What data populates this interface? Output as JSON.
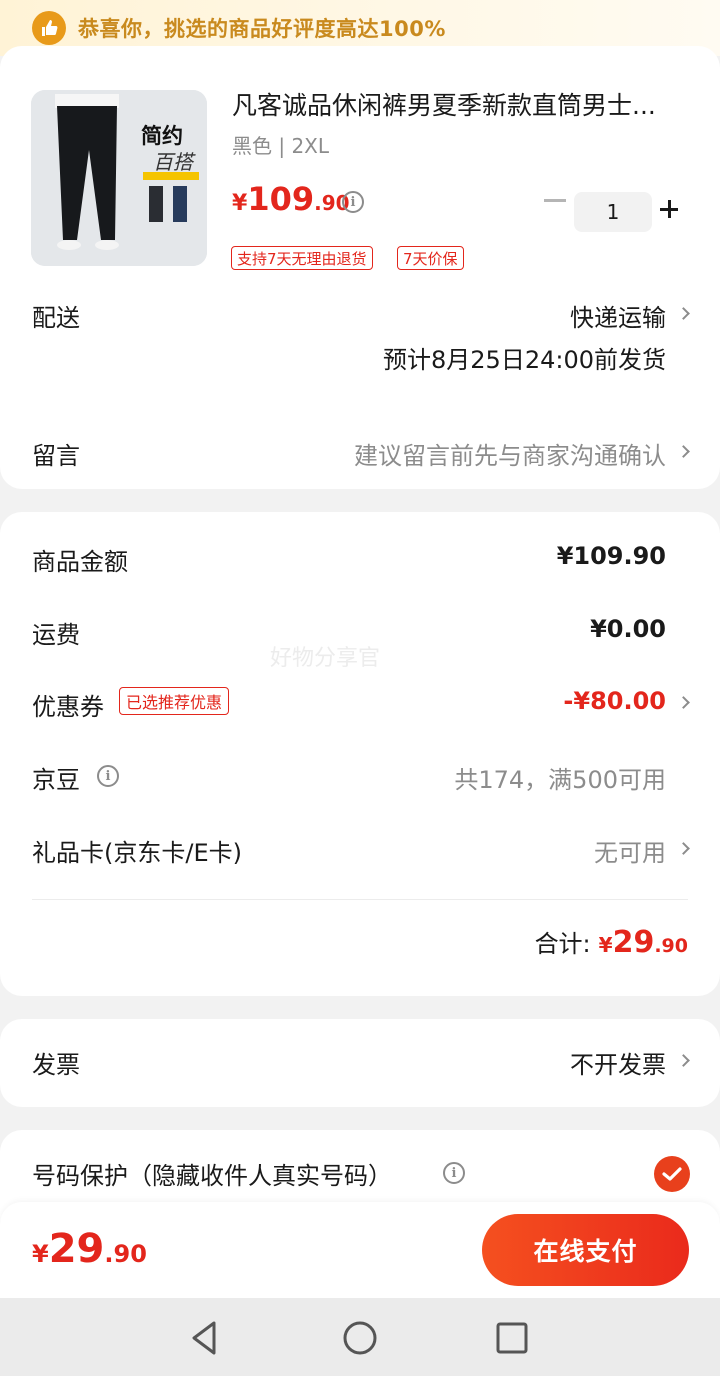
{
  "banner": {
    "text": "恭喜你，挑选的商品好评度高达100%",
    "icon": "thumbs-up-icon"
  },
  "product": {
    "title": "凡客诚品休闲裤男夏季新款直筒男士...",
    "spec": "黑色 | 2XL",
    "price": {
      "symbol": "¥",
      "integer": "109",
      "decimal": ".90"
    },
    "quantity": "1",
    "image_text": {
      "line1": "简约",
      "line2": "百搭"
    },
    "tags": [
      "支持7天无理由退货",
      "7天价保"
    ]
  },
  "delivery": {
    "label": "配送",
    "method": "快递运输",
    "eta": "预计8月25日24:00前发货"
  },
  "message": {
    "label": "留言",
    "placeholder": "建议留言前先与商家沟通确认"
  },
  "summary": {
    "goods_amount_label": "商品金额",
    "goods_amount": "¥109.90",
    "shipping_label": "运费",
    "shipping": "¥0.00",
    "coupon_label": "优惠券",
    "coupon_badge": "已选推荐优惠",
    "coupon_value": "-¥80.00",
    "jd_beans_label": "京豆",
    "jd_beans_value": "共174，满500可用",
    "gift_card_label": "礼品卡(京东卡/E卡)",
    "gift_card_value": "无可用",
    "total_label": "合计:",
    "total": {
      "symbol": "¥",
      "integer": "29",
      "decimal": ".90"
    },
    "watermark": "好物分享官"
  },
  "invoice": {
    "label": "发票",
    "value": "不开发票"
  },
  "phone_protection": {
    "label": "号码保护（隐藏收件人真实号码）",
    "checked": true
  },
  "bottom": {
    "total": {
      "symbol": "¥",
      "integer": "29",
      "decimal": ".90"
    },
    "pay_label": "在线支付"
  },
  "colors": {
    "accent_red": "#e3261c",
    "pay_button": "#f04a1e",
    "banner_text": "#c98a1e"
  }
}
